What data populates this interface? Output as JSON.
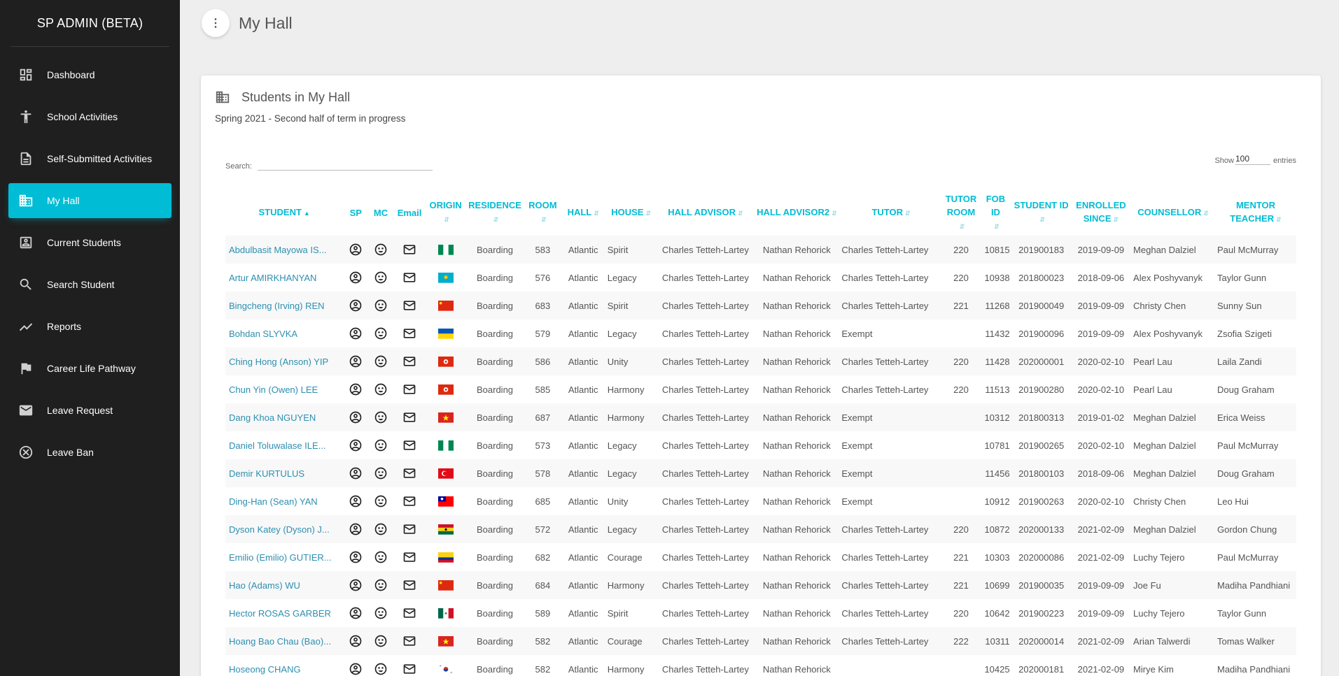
{
  "app": {
    "title": "SP ADMIN (BETA)"
  },
  "sidebar": {
    "items": [
      {
        "label": "Dashboard",
        "icon": "dashboard-icon",
        "active": false
      },
      {
        "label": "School Activities",
        "icon": "person-activity-icon",
        "active": false
      },
      {
        "label": "Self-Submitted Activities",
        "icon": "document-icon",
        "active": false
      },
      {
        "label": "My Hall",
        "icon": "building-icon",
        "active": true
      },
      {
        "label": "Current Students",
        "icon": "id-badge-icon",
        "active": false
      },
      {
        "label": "Search Student",
        "icon": "search-icon",
        "active": false
      },
      {
        "label": "Reports",
        "icon": "trending-up-icon",
        "active": false
      },
      {
        "label": "Career Life Pathway",
        "icon": "flag-icon",
        "active": false
      },
      {
        "label": "Leave Request",
        "icon": "mail-icon",
        "active": false
      },
      {
        "label": "Leave Ban",
        "icon": "cancel-circle-icon",
        "active": false
      }
    ]
  },
  "header": {
    "title": "My Hall",
    "menu_icon": "more-vert-icon"
  },
  "card": {
    "title": "Students in My Hall",
    "subtitle": "Spring 2021 - Second half of term in progress",
    "search_label": "Search:",
    "search_value": "",
    "show_label": "Show",
    "entries_value": "100",
    "entries_label": "entries"
  },
  "table": {
    "columns": [
      "STUDENT",
      "SP",
      "MC",
      "Email",
      "ORIGIN",
      "RESIDENCE",
      "ROOM",
      "HALL",
      "HOUSE",
      "HALL ADVISOR",
      "HALL ADVISOR2",
      "TUTOR",
      "TUTOR ROOM",
      "FOB ID",
      "STUDENT ID",
      "ENROLLED SINCE",
      "COUNSELLOR",
      "MENTOR TEACHER"
    ],
    "rows": [
      {
        "student": "Abdulbasit Mayowa IS...",
        "origin": "NG",
        "residence": "Boarding",
        "room": "583",
        "hall": "Atlantic",
        "house": "Spirit",
        "advisor": "Charles Tetteh-Lartey",
        "advisor2": "Nathan Rehorick",
        "tutor": "Charles Tetteh-Lartey",
        "tutor_room": "220",
        "fob": "10815",
        "sid": "201900183",
        "enrolled": "2019-09-09",
        "counsellor": "Meghan Dalziel",
        "mentor": "Paul McMurray"
      },
      {
        "student": "Artur AMIRKHANYAN",
        "origin": "KZ",
        "residence": "Boarding",
        "room": "576",
        "hall": "Atlantic",
        "house": "Legacy",
        "advisor": "Charles Tetteh-Lartey",
        "advisor2": "Nathan Rehorick",
        "tutor": "Charles Tetteh-Lartey",
        "tutor_room": "220",
        "fob": "10938",
        "sid": "201800023",
        "enrolled": "2018-09-06",
        "counsellor": "Alex Poshyvanyk",
        "mentor": "Taylor Gunn"
      },
      {
        "student": "Bingcheng (Irving) REN",
        "origin": "CN",
        "residence": "Boarding",
        "room": "683",
        "hall": "Atlantic",
        "house": "Spirit",
        "advisor": "Charles Tetteh-Lartey",
        "advisor2": "Nathan Rehorick",
        "tutor": "Charles Tetteh-Lartey",
        "tutor_room": "221",
        "fob": "11268",
        "sid": "201900049",
        "enrolled": "2019-09-09",
        "counsellor": "Christy Chen",
        "mentor": "Sunny Sun"
      },
      {
        "student": "Bohdan SLYVKA",
        "origin": "UA",
        "residence": "Boarding",
        "room": "579",
        "hall": "Atlantic",
        "house": "Legacy",
        "advisor": "Charles Tetteh-Lartey",
        "advisor2": "Nathan Rehorick",
        "tutor": "Exempt",
        "tutor_room": "",
        "fob": "11432",
        "sid": "201900096",
        "enrolled": "2019-09-09",
        "counsellor": "Alex Poshyvanyk",
        "mentor": "Zsofia Szigeti"
      },
      {
        "student": "Ching Hong (Anson) YIP",
        "origin": "HK",
        "residence": "Boarding",
        "room": "586",
        "hall": "Atlantic",
        "house": "Unity",
        "advisor": "Charles Tetteh-Lartey",
        "advisor2": "Nathan Rehorick",
        "tutor": "Charles Tetteh-Lartey",
        "tutor_room": "220",
        "fob": "11428",
        "sid": "202000001",
        "enrolled": "2020-02-10",
        "counsellor": "Pearl Lau",
        "mentor": "Laila Zandi"
      },
      {
        "student": "Chun Yin (Owen) LEE",
        "origin": "HK",
        "residence": "Boarding",
        "room": "585",
        "hall": "Atlantic",
        "house": "Harmony",
        "advisor": "Charles Tetteh-Lartey",
        "advisor2": "Nathan Rehorick",
        "tutor": "Charles Tetteh-Lartey",
        "tutor_room": "220",
        "fob": "11513",
        "sid": "201900280",
        "enrolled": "2020-02-10",
        "counsellor": "Pearl Lau",
        "mentor": "Doug Graham"
      },
      {
        "student": "Dang Khoa NGUYEN",
        "origin": "VN",
        "residence": "Boarding",
        "room": "687",
        "hall": "Atlantic",
        "house": "Harmony",
        "advisor": "Charles Tetteh-Lartey",
        "advisor2": "Nathan Rehorick",
        "tutor": "Exempt",
        "tutor_room": "",
        "fob": "10312",
        "sid": "201800313",
        "enrolled": "2019-01-02",
        "counsellor": "Meghan Dalziel",
        "mentor": "Erica Weiss"
      },
      {
        "student": "Daniel Toluwalase ILE...",
        "origin": "NG",
        "residence": "Boarding",
        "room": "573",
        "hall": "Atlantic",
        "house": "Legacy",
        "advisor": "Charles Tetteh-Lartey",
        "advisor2": "Nathan Rehorick",
        "tutor": "Exempt",
        "tutor_room": "",
        "fob": "10781",
        "sid": "201900265",
        "enrolled": "2020-02-10",
        "counsellor": "Meghan Dalziel",
        "mentor": "Paul McMurray"
      },
      {
        "student": "Demir KURTULUS",
        "origin": "TR",
        "residence": "Boarding",
        "room": "578",
        "hall": "Atlantic",
        "house": "Legacy",
        "advisor": "Charles Tetteh-Lartey",
        "advisor2": "Nathan Rehorick",
        "tutor": "Exempt",
        "tutor_room": "",
        "fob": "11456",
        "sid": "201800103",
        "enrolled": "2018-09-06",
        "counsellor": "Meghan Dalziel",
        "mentor": "Doug Graham"
      },
      {
        "student": "Ding-Han (Sean) YAN",
        "origin": "TW",
        "residence": "Boarding",
        "room": "685",
        "hall": "Atlantic",
        "house": "Unity",
        "advisor": "Charles Tetteh-Lartey",
        "advisor2": "Nathan Rehorick",
        "tutor": "Exempt",
        "tutor_room": "",
        "fob": "10912",
        "sid": "201900263",
        "enrolled": "2020-02-10",
        "counsellor": "Christy Chen",
        "mentor": "Leo Hui"
      },
      {
        "student": "Dyson Katey (Dyson) J...",
        "origin": "GH",
        "residence": "Boarding",
        "room": "572",
        "hall": "Atlantic",
        "house": "Legacy",
        "advisor": "Charles Tetteh-Lartey",
        "advisor2": "Nathan Rehorick",
        "tutor": "Charles Tetteh-Lartey",
        "tutor_room": "220",
        "fob": "10872",
        "sid": "202000133",
        "enrolled": "2021-02-09",
        "counsellor": "Meghan Dalziel",
        "mentor": "Gordon Chung"
      },
      {
        "student": "Emilio (Emilio) GUTIER...",
        "origin": "CO",
        "residence": "Boarding",
        "room": "682",
        "hall": "Atlantic",
        "house": "Courage",
        "advisor": "Charles Tetteh-Lartey",
        "advisor2": "Nathan Rehorick",
        "tutor": "Charles Tetteh-Lartey",
        "tutor_room": "221",
        "fob": "10303",
        "sid": "202000086",
        "enrolled": "2021-02-09",
        "counsellor": "Luchy Tejero",
        "mentor": "Paul McMurray"
      },
      {
        "student": "Hao (Adams) WU",
        "origin": "CN",
        "residence": "Boarding",
        "room": "684",
        "hall": "Atlantic",
        "house": "Harmony",
        "advisor": "Charles Tetteh-Lartey",
        "advisor2": "Nathan Rehorick",
        "tutor": "Charles Tetteh-Lartey",
        "tutor_room": "221",
        "fob": "10699",
        "sid": "201900035",
        "enrolled": "2019-09-09",
        "counsellor": "Joe Fu",
        "mentor": "Madiha Pandhiani"
      },
      {
        "student": "Hector ROSAS GARBER",
        "origin": "MX",
        "residence": "Boarding",
        "room": "589",
        "hall": "Atlantic",
        "house": "Spirit",
        "advisor": "Charles Tetteh-Lartey",
        "advisor2": "Nathan Rehorick",
        "tutor": "Charles Tetteh-Lartey",
        "tutor_room": "220",
        "fob": "10642",
        "sid": "201900223",
        "enrolled": "2019-09-09",
        "counsellor": "Luchy Tejero",
        "mentor": "Taylor Gunn"
      },
      {
        "student": "Hoang Bao Chau (Bao)...",
        "origin": "VN",
        "residence": "Boarding",
        "room": "582",
        "hall": "Atlantic",
        "house": "Courage",
        "advisor": "Charles Tetteh-Lartey",
        "advisor2": "Nathan Rehorick",
        "tutor": "Charles Tetteh-Lartey",
        "tutor_room": "222",
        "fob": "10311",
        "sid": "202000014",
        "enrolled": "2021-02-09",
        "counsellor": "Arian Talwerdi",
        "mentor": "Tomas Walker"
      },
      {
        "student": "Hoseong CHANG",
        "origin": "KR",
        "residence": "Boarding",
        "room": "582",
        "hall": "Atlantic",
        "house": "Harmony",
        "advisor": "Charles Tetteh-Lartey",
        "advisor2": "Nathan Rehorick",
        "tutor": "",
        "tutor_room": "",
        "fob": "10425",
        "sid": "202000181",
        "enrolled": "2021-02-09",
        "counsellor": "Mirye Kim",
        "mentor": "Madiha Pandhiani"
      }
    ]
  }
}
